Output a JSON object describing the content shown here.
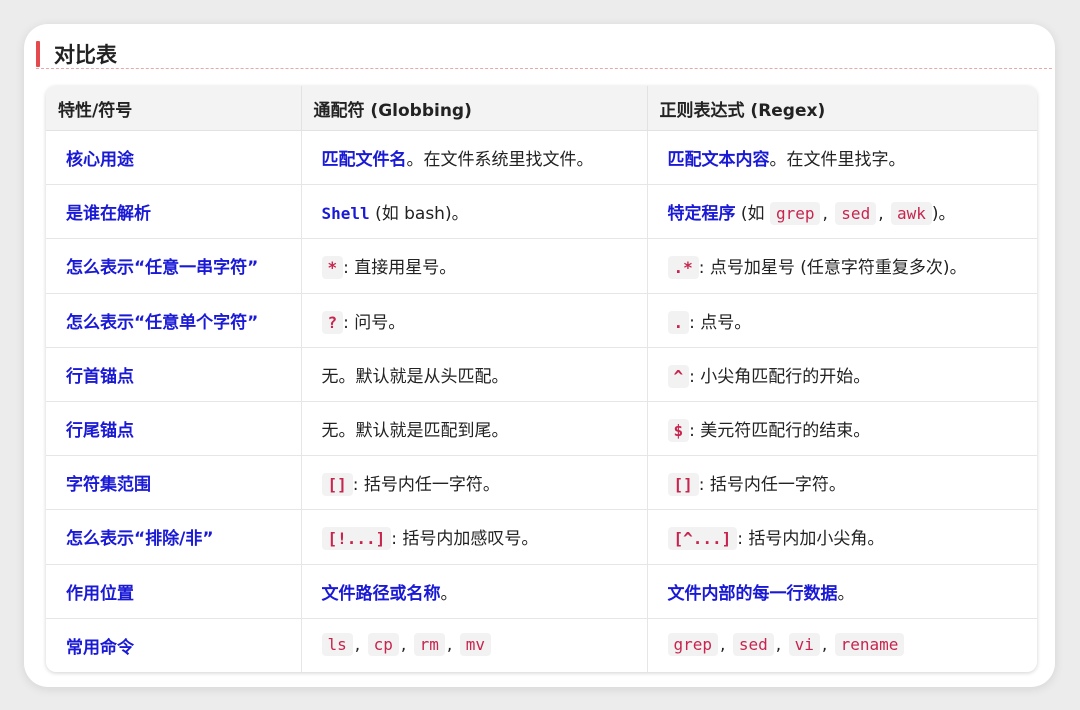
{
  "title": "对比表",
  "headers": [
    "特性/符号",
    "通配符 (Globbing)",
    "正则表达式 (Regex)"
  ],
  "rows": [
    {
      "feature": "核心用途",
      "glob": {
        "bold": "匹配文件名",
        "text": "。在文件系统里找文件。"
      },
      "regex": {
        "bold": "匹配文本内容",
        "text": "。在文件里找字。"
      }
    },
    {
      "feature": "是谁在解析",
      "glob": {
        "bold": "Shell",
        "text": " (如 bash)。"
      },
      "regex": {
        "bold": "特定程序",
        "pre": " (如 ",
        "codes": [
          "grep",
          "sed",
          "awk"
        ],
        "post": ")。"
      }
    },
    {
      "feature": "怎么表示“任意一串字符”",
      "glob": {
        "code": "*",
        "text": ": 直接用星号。"
      },
      "regex": {
        "code": ".*",
        "text": ": 点号加星号 (任意字符重复多次)。"
      }
    },
    {
      "feature": "怎么表示“任意单个字符”",
      "glob": {
        "code": "?",
        "text": ": 问号。"
      },
      "regex": {
        "code": ".",
        "text": ": 点号。"
      }
    },
    {
      "feature": "行首锚点",
      "glob": {
        "text": "无。默认就是从头匹配。"
      },
      "regex": {
        "code": "^",
        "text": ": 小尖角匹配行的开始。"
      }
    },
    {
      "feature": "行尾锚点",
      "glob": {
        "text": "无。默认就是匹配到尾。"
      },
      "regex": {
        "code": "$",
        "text": ": 美元符匹配行的结束。"
      }
    },
    {
      "feature": "字符集范围",
      "glob": {
        "code": "[]",
        "text": ": 括号内任一字符。"
      },
      "regex": {
        "code": "[]",
        "text": ": 括号内任一字符。"
      }
    },
    {
      "feature": "怎么表示“排除/非”",
      "glob": {
        "code": "[!...]",
        "text": ": 括号内加感叹号。"
      },
      "regex": {
        "code": "[^...]",
        "text": ": 括号内加小尖角。"
      }
    },
    {
      "feature": "作用位置",
      "glob": {
        "bold": "文件路径或名称",
        "text": "。"
      },
      "regex": {
        "bold": "文件内部的每一行数据",
        "text": "。"
      }
    },
    {
      "feature": "常用命令",
      "glob": {
        "codes": [
          "ls",
          "cp",
          "rm",
          "mv"
        ]
      },
      "regex": {
        "codes": [
          "grep",
          "sed",
          "vi",
          "rename"
        ]
      }
    }
  ],
  "separator": ",",
  "colors": {
    "accent": "#e5484d",
    "feature": "#1a1ad6",
    "code": "#c7254e",
    "code_bg": "#f2f2f2",
    "header_bg": "#f3f3f3"
  }
}
